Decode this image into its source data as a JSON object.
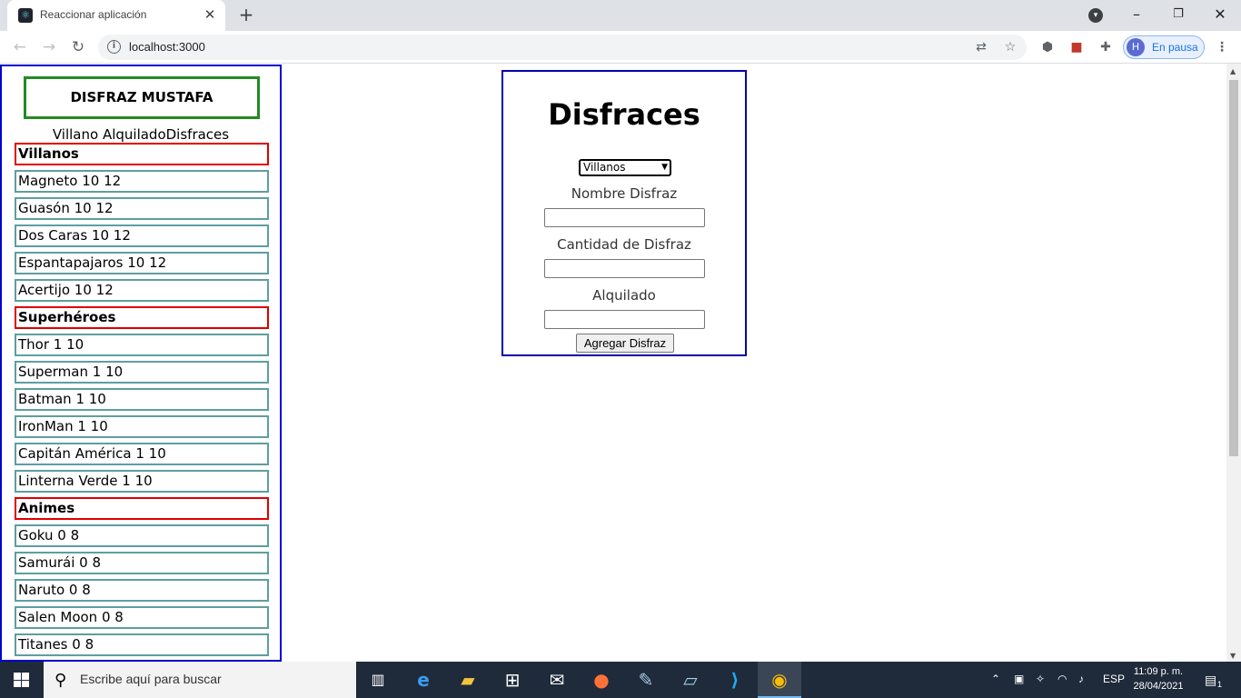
{
  "browser": {
    "tab_title": "Reaccionar aplicación",
    "url": "localhost:3000",
    "profile_initial": "H",
    "profile_status": "En pausa"
  },
  "sidebar": {
    "title": "DISFRAZ MUSTAFA",
    "subheading": "Villano AlquiladoDisfraces",
    "rows": [
      {
        "text": "Villanos",
        "type": "category"
      },
      {
        "text": "Magneto 10 12",
        "type": "item"
      },
      {
        "text": "Guasón 10 12",
        "type": "item"
      },
      {
        "text": "Dos Caras 10 12",
        "type": "item"
      },
      {
        "text": "Espantapajaros 10 12",
        "type": "item"
      },
      {
        "text": "Acertijo 10 12",
        "type": "item"
      },
      {
        "text": "Superhéroes",
        "type": "category"
      },
      {
        "text": "Thor 1 10",
        "type": "item"
      },
      {
        "text": "Superman 1 10",
        "type": "item"
      },
      {
        "text": "Batman 1 10",
        "type": "item"
      },
      {
        "text": "IronMan 1 10",
        "type": "item"
      },
      {
        "text": "Capitán América 1 10",
        "type": "item"
      },
      {
        "text": "Linterna Verde 1 10",
        "type": "item"
      },
      {
        "text": "Animes",
        "type": "category"
      },
      {
        "text": "Goku 0 8",
        "type": "item"
      },
      {
        "text": "Samurái 0 8",
        "type": "item"
      },
      {
        "text": "Naruto 0 8",
        "type": "item"
      },
      {
        "text": "Salen Moon 0 8",
        "type": "item"
      },
      {
        "text": "Titanes 0 8",
        "type": "item"
      }
    ]
  },
  "form": {
    "title": "Disfraces",
    "category_selected": "Villanos",
    "name_label": "Nombre Disfraz",
    "name_value": "",
    "quantity_label": "Cantidad de Disfraz",
    "quantity_value": "",
    "rented_label": "Alquilado",
    "rented_value": "",
    "submit_label": "Agregar Disfraz"
  },
  "taskbar": {
    "search_placeholder": "Escribe aquí para buscar",
    "language": "ESP",
    "time": "11:09 p. m.",
    "date": "28/04/2021",
    "notification_count": "1"
  },
  "colors": {
    "sidebar_border": "#0000cc",
    "title_border": "#228b22",
    "category_border": "#dd0000",
    "item_border": "#5f9ea0",
    "form_border": "#0000aa"
  }
}
